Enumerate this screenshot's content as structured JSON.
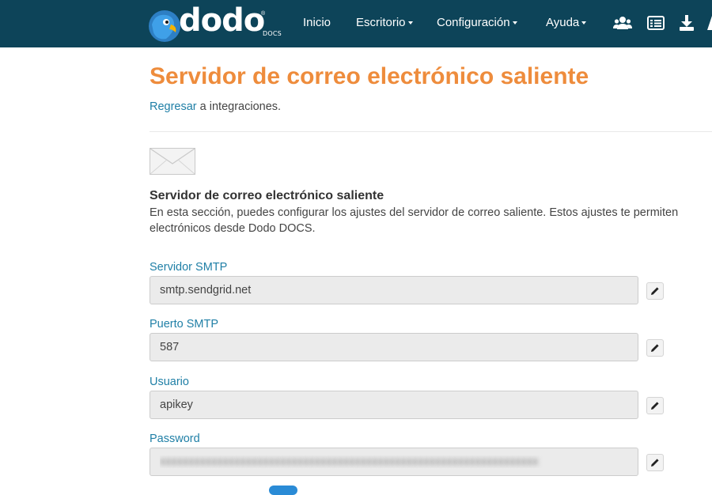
{
  "navbar": {
    "logo": {
      "text": "dodo",
      "sub": "DOCS",
      "reg": "®"
    },
    "items": [
      {
        "label": "Inicio",
        "dropdown": false
      },
      {
        "label": "Escritorio",
        "dropdown": true
      },
      {
        "label": "Configuración",
        "dropdown": true
      },
      {
        "label": "Ayuda",
        "dropdown": true
      }
    ],
    "icons": [
      "users-icon",
      "list-icon",
      "download-icon"
    ]
  },
  "page": {
    "title": "Servidor de correo electrónico saliente",
    "back": {
      "link": "Regresar",
      "suffix": " a integraciones."
    }
  },
  "section": {
    "icon": "envelope-icon",
    "title": "Servidor de correo electrónico saliente",
    "description": "En esta sección, puedes configurar los ajustes del servidor de correo saliente. Estos ajustes te permiten electrónicos desde Dodo DOCS."
  },
  "fields": [
    {
      "label": "Servidor SMTP",
      "value": "smtp.sendgrid.net"
    },
    {
      "label": "Puerto SMTP",
      "value": "587"
    },
    {
      "label": "Usuario",
      "value": "apikey"
    },
    {
      "label": "Password",
      "value": "xxxxxxxxxxxxxxxxxxxxxxxxxxxxxxxxxxxxxxxxxxxxxxxxxxxxxxxxxxxxxxxxxx",
      "obscured": true
    }
  ],
  "colors": {
    "navbar": "#0d4459",
    "title": "#ee8c3c",
    "link": "#1f7fa6",
    "input_bg": "#ebebeb"
  }
}
